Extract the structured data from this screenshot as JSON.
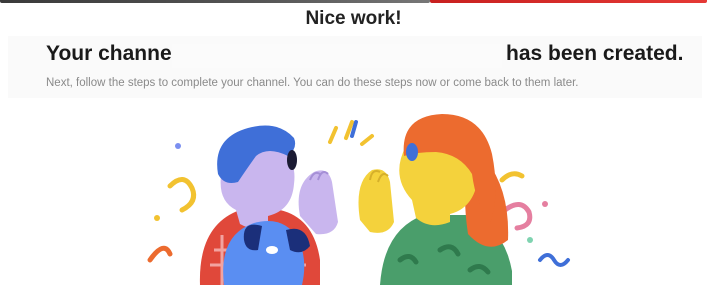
{
  "header": {
    "nice_work": "Nice work!"
  },
  "channel": {
    "title_prefix": "Your channel",
    "title_suffix": "has been created.",
    "subtext": "Next, follow the steps to complete your channel. You can do these steps now or come back to them later."
  },
  "colors": {
    "accent_red": "#e53935",
    "hair_blue": "#3f6fd8",
    "hair_orange": "#ec6b2f",
    "skin_lilac": "#c9b6ee",
    "skin_yellow": "#f4d23c",
    "shirt_red": "#e0483a",
    "shirt_green": "#4a9e6b"
  }
}
